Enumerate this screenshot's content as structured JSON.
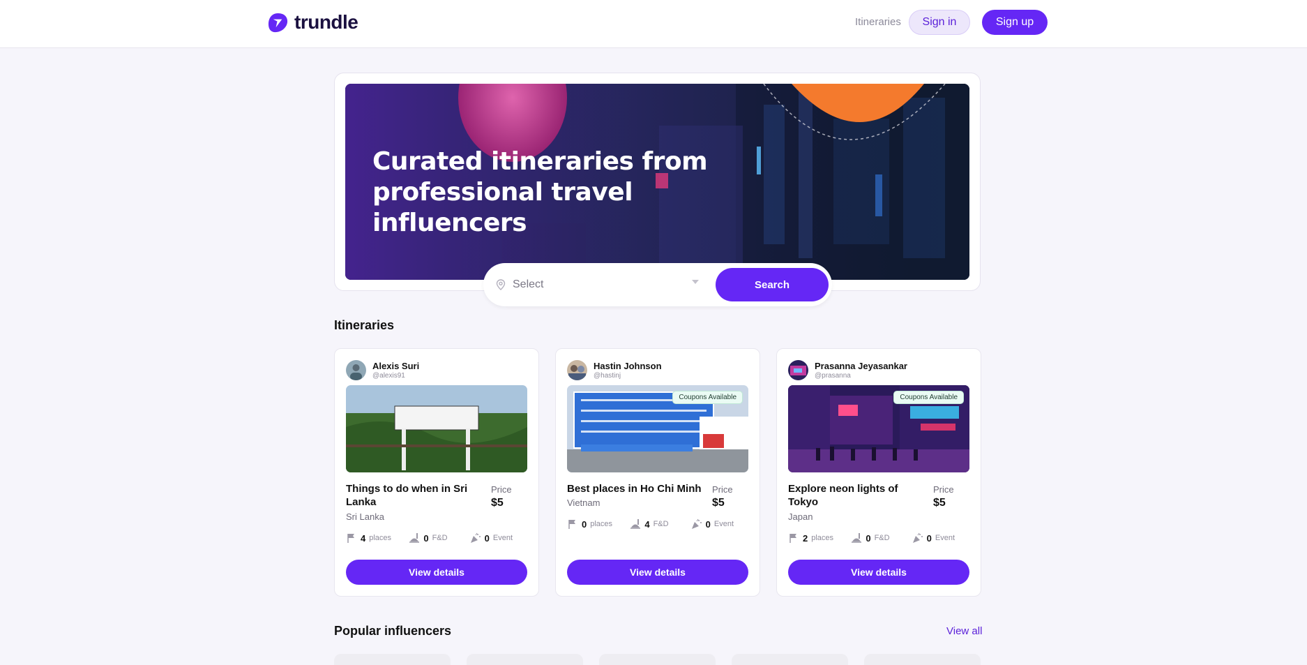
{
  "header": {
    "brand": "trundle",
    "nav_itineraries": "Itineraries",
    "sign_in": "Sign in",
    "sign_up": "Sign up"
  },
  "hero": {
    "title": "Curated itineraries from professional travel influencers",
    "search_placeholder": "Select",
    "search_button": "Search"
  },
  "sections": {
    "itineraries": "Itineraries",
    "popular_influencers": "Popular influencers",
    "view_all": "View all"
  },
  "cards": [
    {
      "author_name": "Alexis Suri",
      "author_handle": "@alexis91",
      "coupon": "",
      "title": "Things to do when in Sri Lanka",
      "location": "Sri Lanka",
      "price_label": "Price",
      "price": "$5",
      "places": "4",
      "places_label": "places",
      "fnd": "0",
      "fnd_label": "F&D",
      "events": "0",
      "events_label": "Event",
      "button": "View details"
    },
    {
      "author_name": "Hastin Johnson",
      "author_handle": "@hastinj",
      "coupon": "Coupons Available",
      "title": "Best places in Ho Chi Minh",
      "location": "Vietnam",
      "price_label": "Price",
      "price": "$5",
      "places": "0",
      "places_label": "places",
      "fnd": "4",
      "fnd_label": "F&D",
      "events": "0",
      "events_label": "Event",
      "button": "View details"
    },
    {
      "author_name": "Prasanna Jeyasankar",
      "author_handle": "@prasanna",
      "coupon": "Coupons Available",
      "title": "Explore neon lights of Tokyo",
      "location": "Japan",
      "price_label": "Price",
      "price": "$5",
      "places": "2",
      "places_label": "places",
      "fnd": "0",
      "fnd_label": "F&D",
      "events": "0",
      "events_label": "Event",
      "button": "View details"
    }
  ],
  "colors": {
    "accent": "#6527f5",
    "background": "#f6f5fb",
    "brand_text": "#1b1140"
  }
}
